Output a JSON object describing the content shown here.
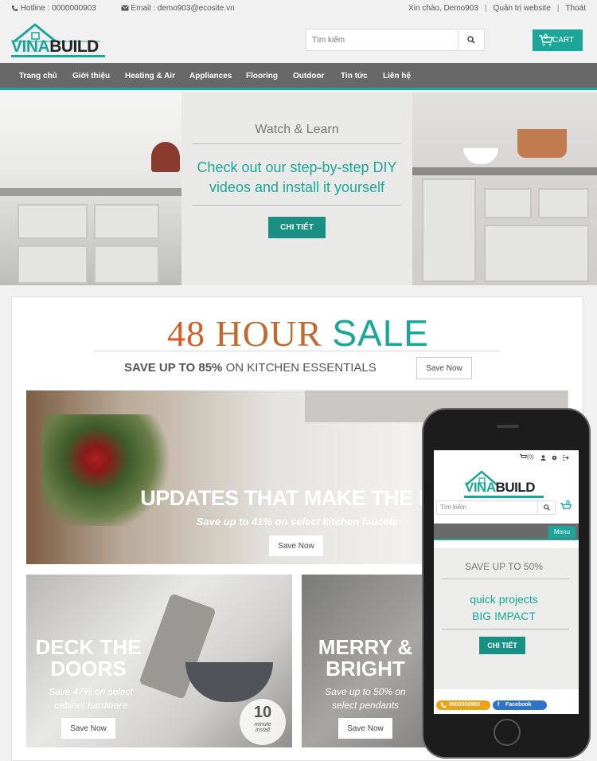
{
  "topbar": {
    "hotline": "Hotline : 0000000903",
    "email": "Email : demo903@ecosite.vn",
    "greeting": "Xin chào, Demo903",
    "admin": "Quản trị website",
    "logout": "Thoát"
  },
  "header": {
    "logo_left": "VINA",
    "logo_right": "BUILD",
    "search_placeholder": "Tìm kiếm",
    "cart_count": "0",
    "cart_label": "CART"
  },
  "nav": {
    "items": [
      "Trang chủ",
      "Giới thiệu",
      "Heating & Air",
      "Appliances",
      "Flooring",
      "Outdoor",
      "Tin tức",
      "Liên hệ"
    ]
  },
  "hero": {
    "subtitle": "Watch & Learn",
    "headline_1": "Check out our step-by-step DIY",
    "headline_2": "videos and install it yourself",
    "button": "CHI TIẾT"
  },
  "sale": {
    "num": "48",
    "word1": "HOUR",
    "word2": "SALE",
    "save_bold": "SAVE UP TO 85%",
    "save_rest": "ON KITCHEN ESSENTIALS",
    "save_button": "Save Now"
  },
  "banners": [
    {
      "title": "UPDATES THAT MAKE THE NIC",
      "text": "Save up to 41% on select kitchen faucets",
      "button": "Save Now"
    },
    {
      "title_1": "DECK THE",
      "title_2": "DOORS",
      "text_1": "Save 47% on select",
      "text_2": "cabinet hardware",
      "button": "Save Now",
      "badge_num": "10",
      "badge_1": "minute",
      "badge_2": "install"
    },
    {
      "title_1": "MERRY &",
      "title_2": "BRIGHT",
      "text_1": "Save up to 50% on",
      "text_2": "select pendants",
      "button": "Save Now"
    }
  ],
  "phone": {
    "cart_top": "(0)",
    "logo_left": "VINA",
    "logo_right": "BUILD",
    "search_placeholder": "Tìm kiếm",
    "cart_count": "0",
    "menu": "Menu",
    "subtitle": "SAVE UP TO 50%",
    "line1": "quick projects",
    "line2": "BIG IMPACT",
    "button": "CHI TIẾT",
    "hotline": "0000000903",
    "facebook": "Facebook"
  },
  "colors": {
    "accent": "#1aa79a",
    "nav": "#686868",
    "sale_orange": "#d35f27"
  }
}
